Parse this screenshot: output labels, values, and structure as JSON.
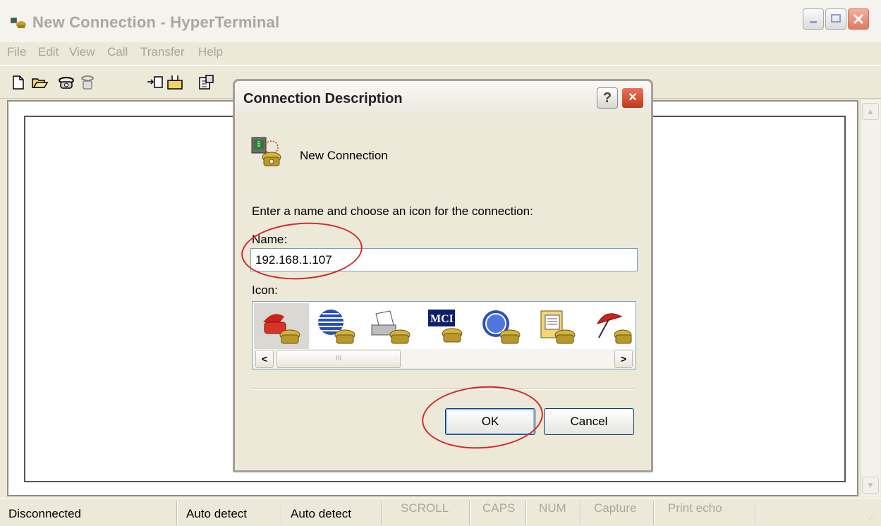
{
  "window": {
    "title": "New Connection - HyperTerminal",
    "icon": "hyperterminal-app-icon"
  },
  "menu": [
    "File",
    "Edit",
    "View",
    "Call",
    "Transfer",
    "Help"
  ],
  "toolbar": {
    "icons": [
      "new-icon",
      "open-icon",
      "call-icon",
      "disconnect-icon",
      "send-icon",
      "receive-icon",
      "properties-icon"
    ]
  },
  "dialog": {
    "title": "Connection Description",
    "help_label": "?",
    "close_label": "×",
    "connection_name_display": "New Connection",
    "prompt": "Enter a name and choose an icon for the connection:",
    "name_label": "Name:",
    "name_value": "192.168.1.107",
    "icon_label": "Icon:",
    "icons": [
      "red-telephone-icon",
      "globe-phone-icon",
      "fax-phone-icon",
      "mci-phone-icon",
      "ge-phone-icon",
      "document-phone-icon",
      "umbrella-phone-icon"
    ],
    "selected_icon": "red-telephone-icon",
    "scroll_left": "<",
    "scroll_right": ">",
    "scroll_thumb": "III",
    "ok_label": "OK",
    "cancel_label": "Cancel"
  },
  "status": {
    "connection": "Disconnected",
    "detect1": "Auto detect",
    "detect2": "Auto detect",
    "scroll": "SCROLL",
    "caps": "CAPS",
    "num": "NUM",
    "capture": "Capture",
    "print_echo": "Print echo"
  },
  "colors": {
    "annotation": "#d42a2a",
    "window_bg": "#ece9d8",
    "close_red": "#c2391b"
  }
}
